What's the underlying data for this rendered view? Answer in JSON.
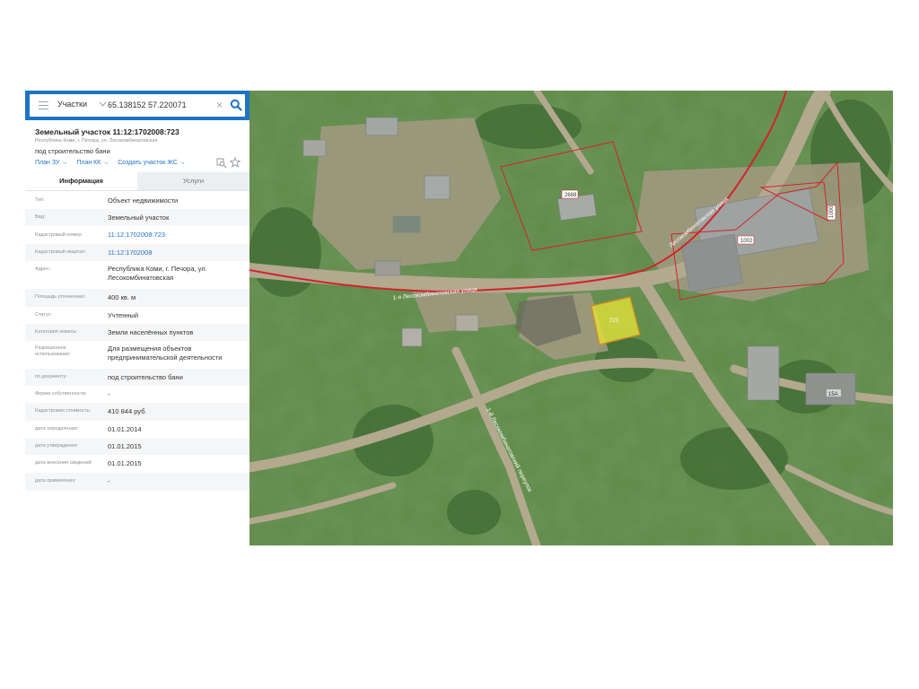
{
  "search": {
    "layer": "Участки",
    "query": "65.138152 57.220071"
  },
  "parcel": {
    "title": "Земельный участок 11:12:1702008:723",
    "address_line": "Республика Коми, г. Печора, ул. Лесокомбинатовская",
    "purpose_line": "под строительство бани",
    "links": {
      "plan_zu": "План ЗУ →",
      "plan_kk": "План КК →",
      "create_zhs": "Создать участок ЖС →"
    }
  },
  "tabs": {
    "info": "Информация",
    "services": "Услуги"
  },
  "info_rows": [
    {
      "label": "Тип:",
      "value": "Объект недвижимости"
    },
    {
      "label": "Вид:",
      "value": "Земельный участок"
    },
    {
      "label": "Кадастровый номер:",
      "value": "11:12:1702008:723"
    },
    {
      "label": "Кадастровый квартал:",
      "value": "11:12:1702008"
    },
    {
      "label": "Адрес:",
      "value": "Республика Коми, г. Печора, ул. Лесокомбинатовская"
    },
    {
      "label": "Площадь уточненная:",
      "value": "400 кв. м"
    },
    {
      "label": "Статус:",
      "value": "Учтенный"
    },
    {
      "label": "Категория земель:",
      "value": "Земли населённых пунктов"
    },
    {
      "label": "Разрешенное использование:",
      "value": "Для размещения объектов предпринимательской деятельности"
    },
    {
      "label": "по документу:",
      "value": "под строительство бани"
    },
    {
      "label": "Форма собственности:",
      "value": "-"
    },
    {
      "label": "Кадастровая стоимость:",
      "value": "410 844 руб."
    },
    {
      "label": "дата определения:",
      "value": "01.01.2014"
    },
    {
      "label": "дата утверждения:",
      "value": "01.01.2015"
    },
    {
      "label": "дата внесения сведений:",
      "value": "01.01.2015"
    },
    {
      "label": "дата применения:",
      "value": "-"
    }
  ],
  "map": {
    "parcel_labels": {
      "p2688": "2688",
      "p1002": "1002",
      "p1000": "1000",
      "p723": "723",
      "house": "15А"
    },
    "street_labels": {
      "street1": "1-я Лесокомбинатовская улица",
      "street2": "Лесокомбинатовская улица",
      "street3": "1-й Лесокомбинатовский переулок"
    }
  },
  "colors": {
    "accent": "#1f73c4",
    "boundary": "#d2232a",
    "selected_parcel": "#e8e63a"
  },
  "icons": {
    "menu": "menu-icon",
    "dropdown": "chevron-down-icon",
    "clear": "close-icon",
    "search": "search-icon",
    "collapse": "chevron-left-icon",
    "zoom": "magnify-icon",
    "favorite": "star-icon"
  }
}
